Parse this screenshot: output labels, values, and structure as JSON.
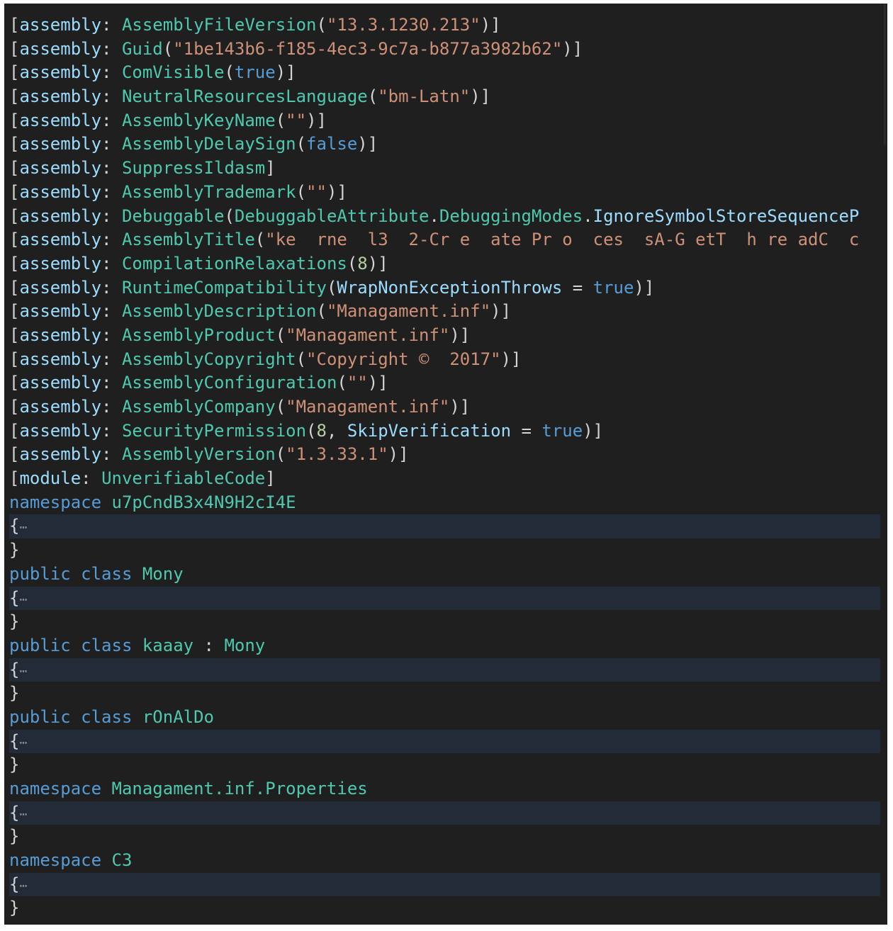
{
  "editor": {
    "attr_lines": [
      {
        "target": "assembly",
        "name": "AssemblyFileVersion",
        "args": [
          {
            "t": "st",
            "v": "\"13.3.1230.213\""
          }
        ]
      },
      {
        "target": "assembly",
        "name": "Guid",
        "args": [
          {
            "t": "st",
            "v": "\"1be143b6-f185-4ec3-9c7a-b877a3982b62\""
          }
        ]
      },
      {
        "target": "assembly",
        "name": "ComVisible",
        "args": [
          {
            "t": "kw",
            "v": "true"
          }
        ]
      },
      {
        "target": "assembly",
        "name": "NeutralResourcesLanguage",
        "args": [
          {
            "t": "st",
            "v": "\"bm-Latn\""
          }
        ]
      },
      {
        "target": "assembly",
        "name": "AssemblyKeyName",
        "args": [
          {
            "t": "st",
            "v": "\"\""
          }
        ]
      },
      {
        "target": "assembly",
        "name": "AssemblyDelaySign",
        "args": [
          {
            "t": "kw",
            "v": "false"
          }
        ]
      },
      {
        "target": "assembly",
        "name": "SuppressIldasm",
        "args": null
      },
      {
        "target": "assembly",
        "name": "AssemblyTrademark",
        "args": [
          {
            "t": "st",
            "v": "\"\""
          }
        ]
      },
      {
        "target": "assembly",
        "name": "Debuggable",
        "args": [
          {
            "t": "ty",
            "v": "DebuggableAttribute"
          },
          {
            "t": "p",
            "v": "."
          },
          {
            "t": "ty",
            "v": "DebuggingModes"
          },
          {
            "t": "p",
            "v": "."
          },
          {
            "t": "id",
            "v": "IgnoreSymbolStoreSequenceP"
          }
        ],
        "open": true
      },
      {
        "target": "assembly",
        "name": "AssemblyTitle",
        "args": [
          {
            "t": "st",
            "v": "\"ke  rne  l3  2-Cr e  ate Pr o  ces  sA-G etT  h re adC  c"
          }
        ],
        "open": true
      },
      {
        "target": "assembly",
        "name": "CompilationRelaxations",
        "args": [
          {
            "t": "nu",
            "v": "8"
          }
        ]
      },
      {
        "target": "assembly",
        "name": "RuntimeCompatibility",
        "args": [
          {
            "t": "id",
            "v": "WrapNonExceptionThrows"
          },
          {
            "t": "p",
            "v": " = "
          },
          {
            "t": "kw",
            "v": "true"
          }
        ]
      },
      {
        "target": "assembly",
        "name": "AssemblyDescription",
        "args": [
          {
            "t": "st",
            "v": "\"Managament.inf\""
          }
        ]
      },
      {
        "target": "assembly",
        "name": "AssemblyProduct",
        "args": [
          {
            "t": "st",
            "v": "\"Managament.inf\""
          }
        ]
      },
      {
        "target": "assembly",
        "name": "AssemblyCopyright",
        "args": [
          {
            "t": "st",
            "v": "\"Copyright ©  2017\""
          }
        ]
      },
      {
        "target": "assembly",
        "name": "AssemblyConfiguration",
        "args": [
          {
            "t": "st",
            "v": "\"\""
          }
        ]
      },
      {
        "target": "assembly",
        "name": "AssemblyCompany",
        "args": [
          {
            "t": "st",
            "v": "\"Managament.inf\""
          }
        ]
      },
      {
        "target": "assembly",
        "name": "SecurityPermission",
        "args": [
          {
            "t": "nu",
            "v": "8"
          },
          {
            "t": "p",
            "v": ", "
          },
          {
            "t": "id",
            "v": "SkipVerification"
          },
          {
            "t": "p",
            "v": " = "
          },
          {
            "t": "kw",
            "v": "true"
          }
        ]
      },
      {
        "target": "assembly",
        "name": "AssemblyVersion",
        "args": [
          {
            "t": "st",
            "v": "\"1.3.33.1\""
          }
        ]
      },
      {
        "target": "module",
        "name": "UnverifiableCode",
        "args": null
      }
    ],
    "blocks": [
      {
        "decl": [
          {
            "t": "kw",
            "v": "namespace"
          },
          {
            "t": "p",
            "v": " "
          },
          {
            "t": "ty",
            "v": "u7pCndB3x4N9H2cI4E"
          }
        ]
      },
      {
        "decl": [
          {
            "t": "kw",
            "v": "public class"
          },
          {
            "t": "p",
            "v": " "
          },
          {
            "t": "ty",
            "v": "Mony"
          }
        ]
      },
      {
        "decl": [
          {
            "t": "kw",
            "v": "public class"
          },
          {
            "t": "p",
            "v": " "
          },
          {
            "t": "ty",
            "v": "kaaay"
          },
          {
            "t": "p",
            "v": " : "
          },
          {
            "t": "ty",
            "v": "Mony"
          }
        ]
      },
      {
        "decl": [
          {
            "t": "kw",
            "v": "public class"
          },
          {
            "t": "p",
            "v": " "
          },
          {
            "t": "ty",
            "v": "rOnAlDo"
          }
        ]
      },
      {
        "decl": [
          {
            "t": "kw",
            "v": "namespace"
          },
          {
            "t": "p",
            "v": " "
          },
          {
            "t": "ty",
            "v": "Managament.inf.Properties"
          }
        ]
      },
      {
        "decl": [
          {
            "t": "kw",
            "v": "namespace"
          },
          {
            "t": "p",
            "v": " "
          },
          {
            "t": "ty",
            "v": "C3"
          }
        ]
      }
    ],
    "fold_open": "{",
    "fold_ellipsis": "⋯",
    "fold_close": "}"
  }
}
